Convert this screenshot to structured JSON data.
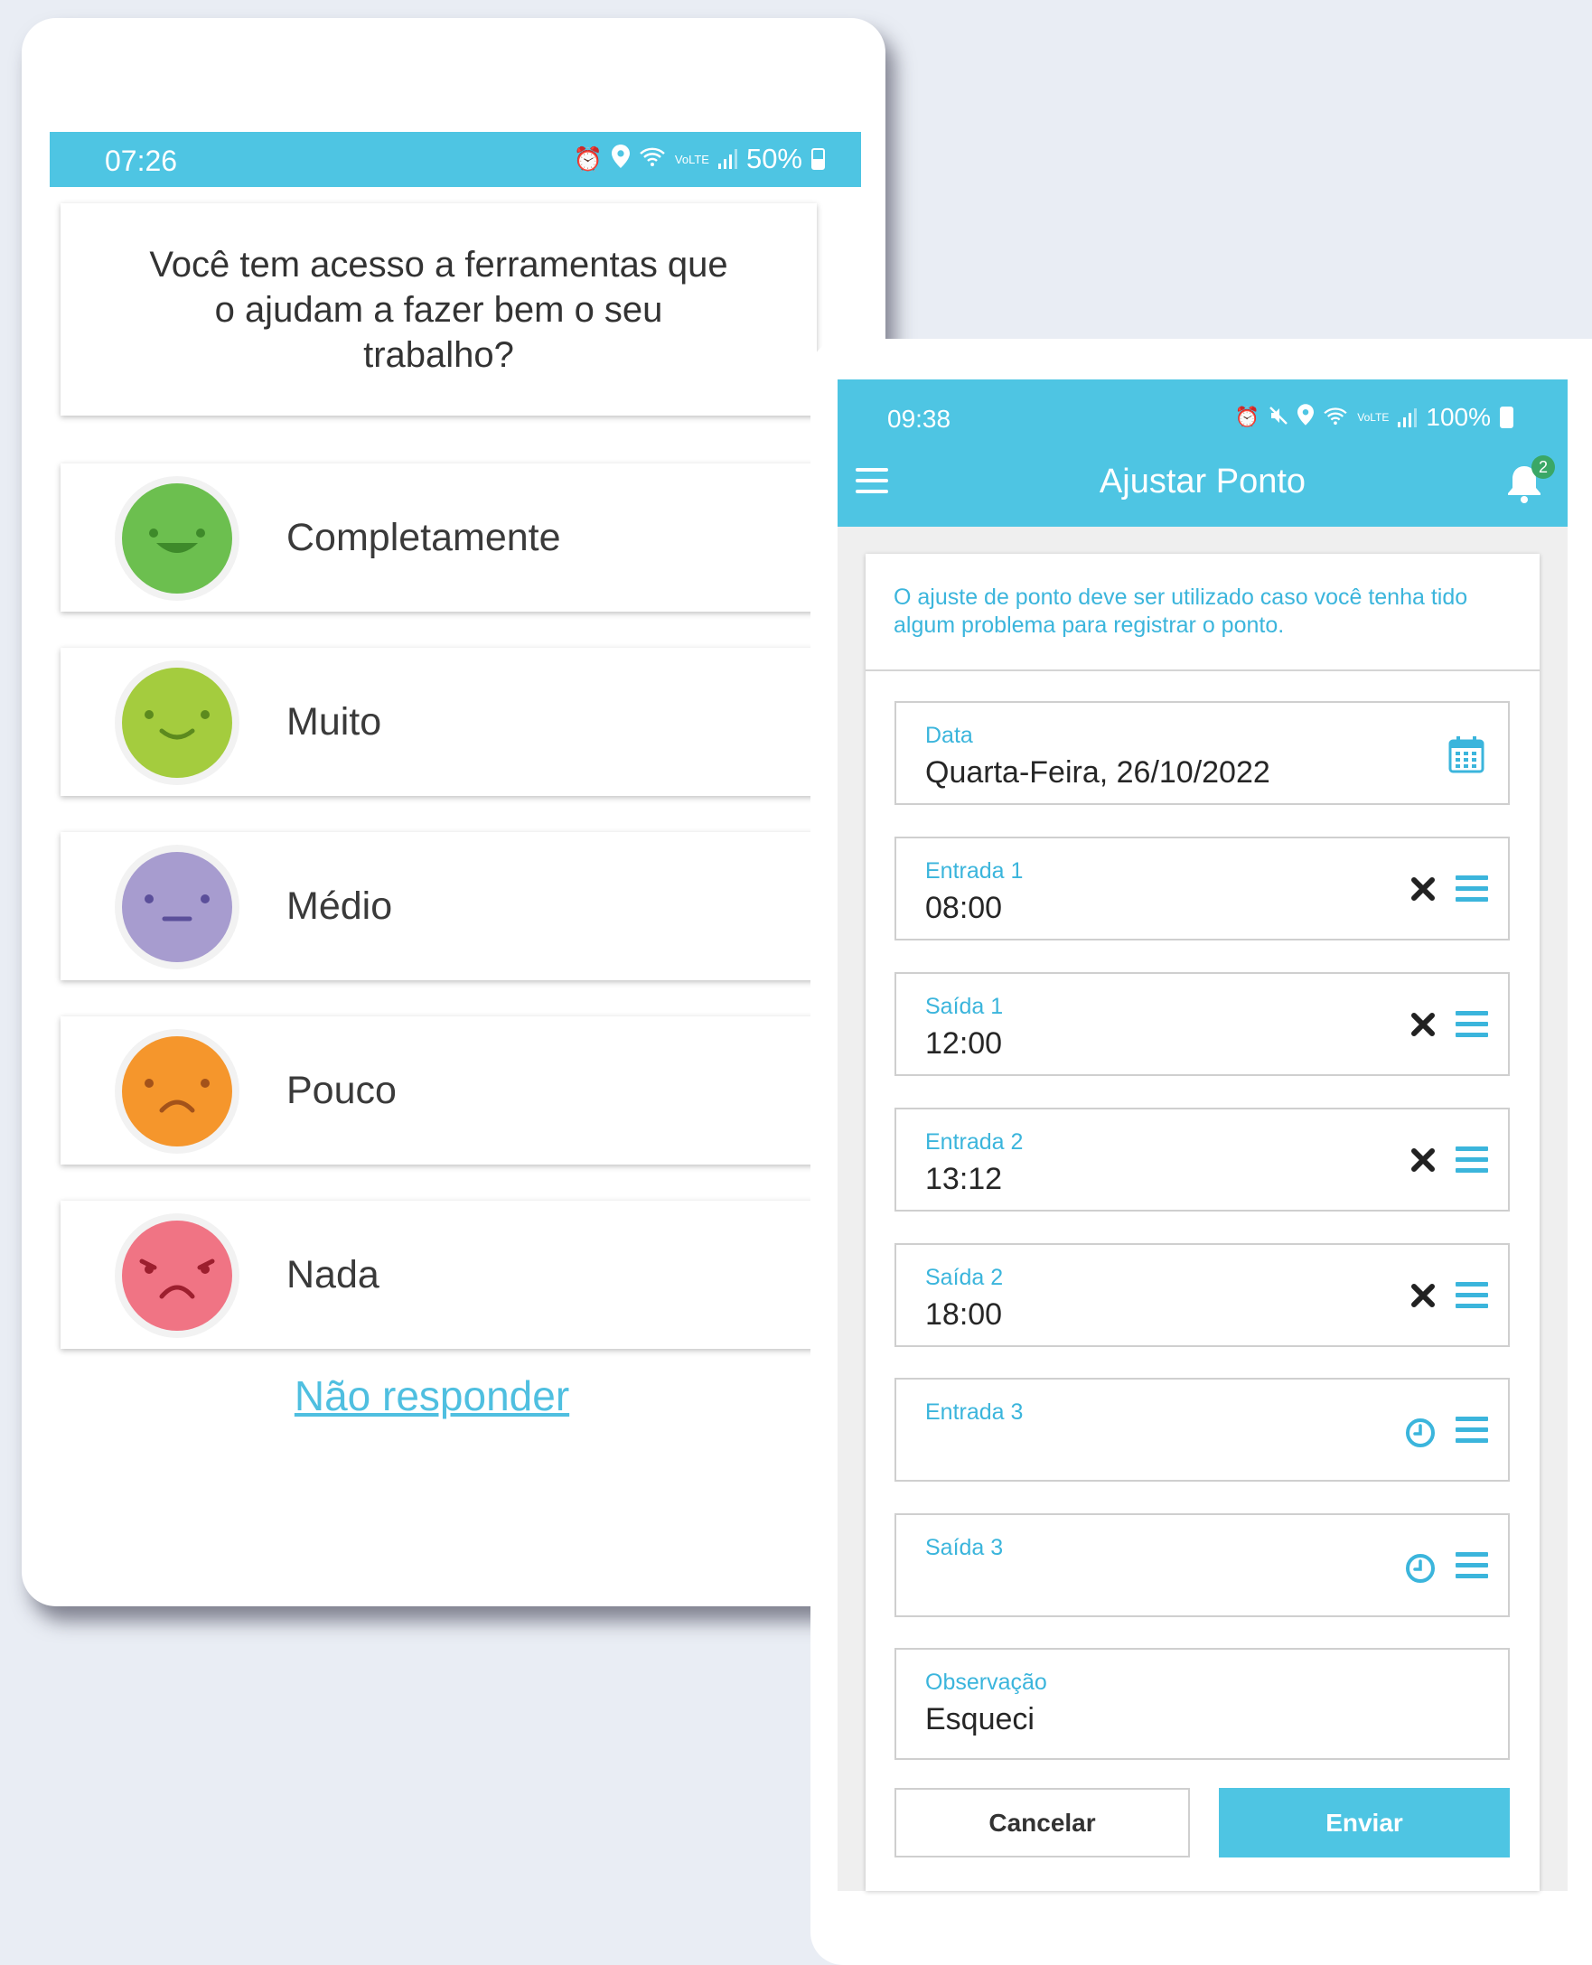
{
  "survey": {
    "status_time": "07:26",
    "status_battery": "50%",
    "question": "Você tem acesso a ferramentas que o ajudam a fazer bem o seu trabalho?",
    "options": [
      {
        "label": "Completamente",
        "color": "#6cbf4f"
      },
      {
        "label": "Muito",
        "color": "#a4cc3e"
      },
      {
        "label": "Médio",
        "color": "#a79ccf"
      },
      {
        "label": "Pouco",
        "color": "#f5962c"
      },
      {
        "label": "Nada",
        "color": "#f07484"
      }
    ],
    "skip_label": "Não responder"
  },
  "punch": {
    "status_time": "09:38",
    "status_battery": "100%",
    "title": "Ajustar Ponto",
    "notification_count": "2",
    "notice": "O ajuste de ponto deve ser utilizado caso você tenha tido algum problema para registrar o ponto.",
    "date": {
      "label": "Data",
      "value": "Quarta-Feira, 26/10/2022",
      "icon": "calendar-icon"
    },
    "entries": [
      {
        "label": "Entrada 1",
        "value": "08:00",
        "icon": "clear-icon"
      },
      {
        "label": "Saída 1",
        "value": "12:00",
        "icon": "clear-icon"
      },
      {
        "label": "Entrada 2",
        "value": "13:12",
        "icon": "clear-icon"
      },
      {
        "label": "Saída 2",
        "value": "18:00",
        "icon": "clear-icon"
      },
      {
        "label": "Entrada 3",
        "value": "",
        "icon": "clock-icon"
      },
      {
        "label": "Saída 3",
        "value": "",
        "icon": "clock-icon"
      }
    ],
    "observation": {
      "label": "Observação",
      "value": "Esqueci"
    },
    "cancel_label": "Cancelar",
    "send_label": "Enviar",
    "accent_color": "#4ec5e3"
  }
}
